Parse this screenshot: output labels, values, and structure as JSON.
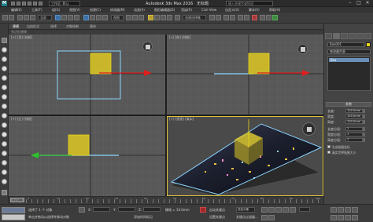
{
  "titlebar": {
    "app_title": "Autodesk 3ds Max 2016",
    "doc_title": "无标题",
    "workspace": "工作区: 默认",
    "search_placeholder": "键入关键字或短语"
  },
  "menu": [
    "编辑(E)",
    "工具(T)",
    "组(G)",
    "视图(V)",
    "创建(C)",
    "修改器(M)",
    "动画(A)",
    "图形编辑器(D)",
    "渲染(R)",
    "Civil View",
    "自定义(U)",
    "脚本(S)",
    "帮助(H)"
  ],
  "toolbar": {
    "selection_filter": "全部",
    "view_dropdown": "视图",
    "selection_set": "创建选择集"
  },
  "ribbon": {
    "tabs": [
      "建模",
      "自由形式",
      "选择",
      "对象绘制",
      "填充"
    ],
    "active": "建模",
    "sub_label": "多边形建模"
  },
  "viewports": {
    "top": "[+] [顶] [线框]",
    "front": "[+] [前] [线框]",
    "left": "[+] [左] [线框]",
    "perspective": "[+] [透视] [真实]"
  },
  "command_panel": {
    "object_name": "Box001",
    "modifier_list": "修改器列表",
    "stack_item": "Box",
    "params_title": "参数",
    "params": [
      {
        "label": "长度:",
        "value": "100.0mm"
      },
      {
        "label": "宽度:",
        "value": "100.0mm"
      },
      {
        "label": "高度:",
        "value": "100.0mm"
      },
      {
        "label": "长度分段:",
        "value": "1"
      },
      {
        "label": "宽度分段:",
        "value": "1"
      },
      {
        "label": "高度分段:",
        "value": "1"
      }
    ],
    "checkboxes": [
      "生成贴图坐标",
      "真实世界贴图大小"
    ]
  },
  "timeline": {
    "slider": "0 / 100",
    "ticks": [
      "0",
      "10",
      "20",
      "30",
      "40",
      "50",
      "60",
      "70",
      "80",
      "90",
      "100"
    ]
  },
  "status": {
    "selected": "选择了 1 个 对象",
    "hint": "单击并拖动以选择并移动对象",
    "x_label": "X:",
    "y_label": "Y:",
    "z_label": "Z:",
    "grid": "栅格 = 10.0mm",
    "auto_key": "自动关键点",
    "set_key": "设置关键点",
    "selected_obj": "选定对象",
    "key_filters": "关键点过滤器...",
    "add_time_tag": "添加时间标记",
    "welcome": "欢迎使用 MAXScr"
  },
  "colors": {
    "box_yellow": "#e8d51c",
    "axis_red": "#e01e1e",
    "axis_green": "#2ec22e",
    "axis_blue": "#3c6fd0",
    "selection_cyan": "#8ad4ff",
    "active_viewport": "#e0c53c"
  }
}
